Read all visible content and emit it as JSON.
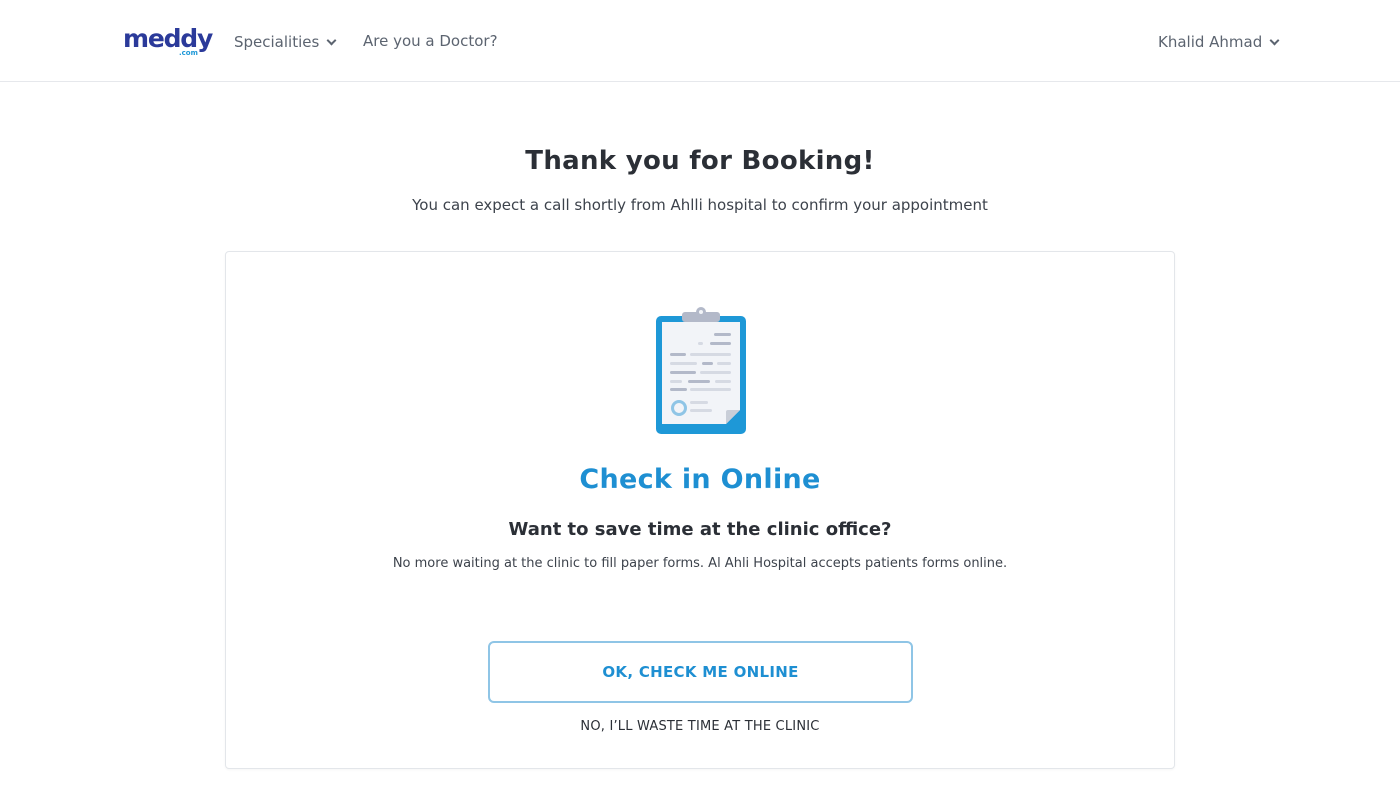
{
  "header": {
    "logo_text": "meddy",
    "logo_sub": ".com",
    "nav": {
      "specialities_label": "Specialities",
      "doctor_label": "Are you a Doctor?"
    },
    "user_name": "Khalid Ahmad"
  },
  "main": {
    "title": "Thank you for Booking!",
    "subtitle": "You can expect a call shortly from Ahlli hospital to confirm your appointment"
  },
  "card": {
    "icon": "clipboard-icon",
    "heading": "Check in Online",
    "question": "Want to save time at the clinic office?",
    "description": "No more waiting at the clinic to fill paper forms. Al Ahli Hospital accepts patients forms online.",
    "primary_button_label": "OK, CHECK ME ONLINE",
    "secondary_button_label": "NO, I’LL WASTE TIME AT THE CLINIC"
  },
  "colors": {
    "brand": "#2b3a9a",
    "accent": "#1e8fd2",
    "text": "#2b2f36",
    "border": "#e3e6ea"
  }
}
